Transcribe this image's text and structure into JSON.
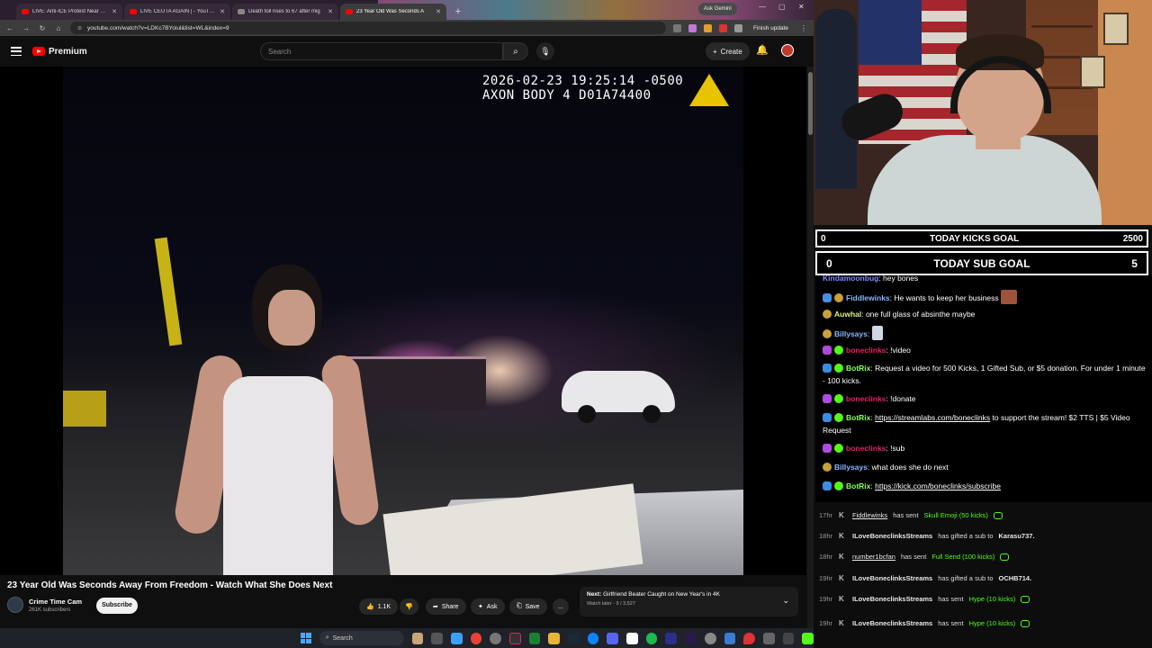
{
  "browser": {
    "tabs": [
      {
        "label": "LIVE: Anti-ICE Protest Near Emi",
        "active": false
      },
      {
        "label": "LIVE CEUTA AGAIN | - YouTube",
        "active": false
      },
      {
        "label": "Death toll rises to 67 after mig",
        "active": false
      },
      {
        "label": "23 Year Old Was Seconds A",
        "active": true
      }
    ],
    "ask_button": "Ask Gemini",
    "url": "youtube.com/watch?v=LDKc7BYoiul&list=WL&index=9",
    "update_button": "Finish update"
  },
  "youtube": {
    "brand": "Premium",
    "search_placeholder": "Search",
    "create_label": "Create",
    "video": {
      "overlay_line1": "2026-02-23 19:25:14 -0500",
      "overlay_line2": "AXON BODY 4 D01A74400"
    },
    "title": "23 Year Old Was Seconds Away From Freedom - Watch What She Does Next",
    "channel": {
      "name": "Crime Time Cam",
      "subscribers": "261K subscribers"
    },
    "subscribe_label": "Subscribe",
    "actions": {
      "likes": "1.1K",
      "share": "Share",
      "ask": "Ask",
      "save": "Save",
      "more": "..."
    },
    "up_next": {
      "prefix": "Next:",
      "title": "Girlfriend Beater Caught on New Year's in 4K",
      "sub": "Watch later - 9 / 3,527"
    }
  },
  "taskbar": {
    "search_placeholder": "Search"
  },
  "goals": [
    {
      "current": "0",
      "label": "TODAY KICKS GOAL",
      "target": "2500"
    },
    {
      "current": "0",
      "label": "TODAY SUB GOAL",
      "target": "5"
    }
  ],
  "chat": [
    {
      "user": "Kindamoonbug",
      "color": "#7a8cff",
      "text": ": hey bones",
      "badge": ""
    },
    {
      "user": "Fiddlewinks",
      "color": "#8ab4ff",
      "text": ": He wants to keep her business",
      "badge": "#4a90e2",
      "emote": true
    },
    {
      "user": "Auwhal",
      "color": "#d9f27a",
      "text": ": one full glass of absinthe maybe",
      "badge": ""
    },
    {
      "user": "Billysays",
      "color": "#8ab4ff",
      "text": ":",
      "badge": "",
      "emote": true
    },
    {
      "user": "boneclinks",
      "color": "#e0245e",
      "text": ": !video",
      "badge": "#53fc18"
    },
    {
      "user": "BotRix",
      "color": "#8cff5a",
      "text": ": Request a video for 500 Kicks, 1 Gifted Sub, or $5 donation. For under 1 minute - 100 kicks.",
      "badge": "#53fc18"
    },
    {
      "user": "boneclinks",
      "color": "#e0245e",
      "text": ": !donate",
      "badge": "#53fc18"
    },
    {
      "user": "BotRix",
      "color": "#8cff5a",
      "text": ": ",
      "link": "https://streamlabs.com/boneclinks",
      "after": " to support the stream! $2 TTS | $5 Video Request",
      "badge": "#53fc18"
    },
    {
      "user": "boneclinks",
      "color": "#e0245e",
      "text": ": !sub",
      "badge": "#53fc18"
    },
    {
      "user": "Billysays",
      "color": "#8ab4ff",
      "text": ": what does she do next",
      "badge": ""
    },
    {
      "user": "BotRix",
      "color": "#8cff5a",
      "text": ": ",
      "link": "https://kick.com/boneclinks/subscribe",
      "after": "",
      "badge": "#53fc18"
    }
  ],
  "events": [
    {
      "age": "17hr",
      "name": "Fiddlewinks",
      "verb": "has sent",
      "item": "Skull Emoji (50 kicks)",
      "kind": "kicks"
    },
    {
      "age": "18hr",
      "name": "ILoveBoneclinksStreams",
      "verb": "has gifted a sub to",
      "item": "Karasu737.",
      "kind": "gift"
    },
    {
      "age": "18hr",
      "name": "number1bcfan",
      "verb": "has sent",
      "item": "Full Send (100 kicks)",
      "kind": "kicks"
    },
    {
      "age": "19hr",
      "name": "ILoveBoneclinksStreams",
      "verb": "has gifted a sub to",
      "item": "OCHB714.",
      "kind": "gift"
    },
    {
      "age": "19hr",
      "name": "ILoveBoneclinksStreams",
      "verb": "has sent",
      "item": "Hype (10 kicks)",
      "kind": "kicks"
    },
    {
      "age": "19hr",
      "name": "ILoveBoneclinksStreams",
      "verb": "has sent",
      "item": "Hype (10 kicks)",
      "kind": "kicks"
    }
  ]
}
